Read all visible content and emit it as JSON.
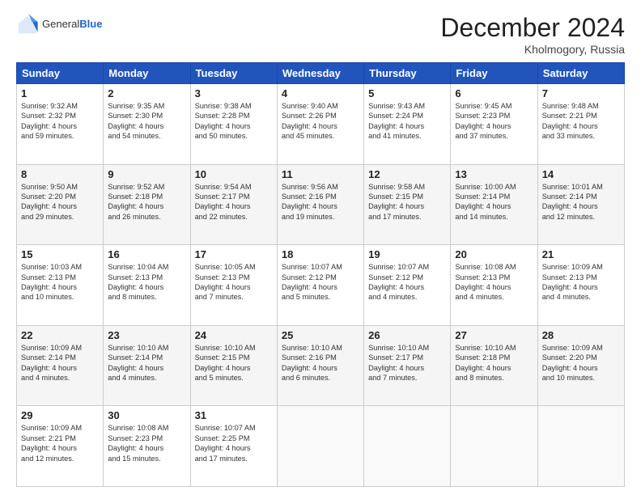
{
  "header": {
    "logo_general": "General",
    "logo_blue": "Blue",
    "title": "December 2024",
    "location": "Kholmogory, Russia"
  },
  "days_of_week": [
    "Sunday",
    "Monday",
    "Tuesday",
    "Wednesday",
    "Thursday",
    "Friday",
    "Saturday"
  ],
  "weeks": [
    [
      {
        "day": "1",
        "sunrise": "9:32 AM",
        "sunset": "2:32 PM",
        "daylight": "4 hours and 59 minutes."
      },
      {
        "day": "2",
        "sunrise": "9:35 AM",
        "sunset": "2:30 PM",
        "daylight": "4 hours and 54 minutes."
      },
      {
        "day": "3",
        "sunrise": "9:38 AM",
        "sunset": "2:28 PM",
        "daylight": "4 hours and 50 minutes."
      },
      {
        "day": "4",
        "sunrise": "9:40 AM",
        "sunset": "2:26 PM",
        "daylight": "4 hours and 45 minutes."
      },
      {
        "day": "5",
        "sunrise": "9:43 AM",
        "sunset": "2:24 PM",
        "daylight": "4 hours and 41 minutes."
      },
      {
        "day": "6",
        "sunrise": "9:45 AM",
        "sunset": "2:23 PM",
        "daylight": "4 hours and 37 minutes."
      },
      {
        "day": "7",
        "sunrise": "9:48 AM",
        "sunset": "2:21 PM",
        "daylight": "4 hours and 33 minutes."
      }
    ],
    [
      {
        "day": "8",
        "sunrise": "9:50 AM",
        "sunset": "2:20 PM",
        "daylight": "4 hours and 29 minutes."
      },
      {
        "day": "9",
        "sunrise": "9:52 AM",
        "sunset": "2:18 PM",
        "daylight": "4 hours and 26 minutes."
      },
      {
        "day": "10",
        "sunrise": "9:54 AM",
        "sunset": "2:17 PM",
        "daylight": "4 hours and 22 minutes."
      },
      {
        "day": "11",
        "sunrise": "9:56 AM",
        "sunset": "2:16 PM",
        "daylight": "4 hours and 19 minutes."
      },
      {
        "day": "12",
        "sunrise": "9:58 AM",
        "sunset": "2:15 PM",
        "daylight": "4 hours and 17 minutes."
      },
      {
        "day": "13",
        "sunrise": "10:00 AM",
        "sunset": "2:14 PM",
        "daylight": "4 hours and 14 minutes."
      },
      {
        "day": "14",
        "sunrise": "10:01 AM",
        "sunset": "2:14 PM",
        "daylight": "4 hours and 12 minutes."
      }
    ],
    [
      {
        "day": "15",
        "sunrise": "10:03 AM",
        "sunset": "2:13 PM",
        "daylight": "4 hours and 10 minutes."
      },
      {
        "day": "16",
        "sunrise": "10:04 AM",
        "sunset": "2:13 PM",
        "daylight": "4 hours and 8 minutes."
      },
      {
        "day": "17",
        "sunrise": "10:05 AM",
        "sunset": "2:13 PM",
        "daylight": "4 hours and 7 minutes."
      },
      {
        "day": "18",
        "sunrise": "10:07 AM",
        "sunset": "2:12 PM",
        "daylight": "4 hours and 5 minutes."
      },
      {
        "day": "19",
        "sunrise": "10:07 AM",
        "sunset": "2:12 PM",
        "daylight": "4 hours and 4 minutes."
      },
      {
        "day": "20",
        "sunrise": "10:08 AM",
        "sunset": "2:13 PM",
        "daylight": "4 hours and 4 minutes."
      },
      {
        "day": "21",
        "sunrise": "10:09 AM",
        "sunset": "2:13 PM",
        "daylight": "4 hours and 4 minutes."
      }
    ],
    [
      {
        "day": "22",
        "sunrise": "10:09 AM",
        "sunset": "2:14 PM",
        "daylight": "4 hours and 4 minutes."
      },
      {
        "day": "23",
        "sunrise": "10:10 AM",
        "sunset": "2:14 PM",
        "daylight": "4 hours and 4 minutes."
      },
      {
        "day": "24",
        "sunrise": "10:10 AM",
        "sunset": "2:15 PM",
        "daylight": "4 hours and 5 minutes."
      },
      {
        "day": "25",
        "sunrise": "10:10 AM",
        "sunset": "2:16 PM",
        "daylight": "4 hours and 6 minutes."
      },
      {
        "day": "26",
        "sunrise": "10:10 AM",
        "sunset": "2:17 PM",
        "daylight": "4 hours and 7 minutes."
      },
      {
        "day": "27",
        "sunrise": "10:10 AM",
        "sunset": "2:18 PM",
        "daylight": "4 hours and 8 minutes."
      },
      {
        "day": "28",
        "sunrise": "10:09 AM",
        "sunset": "2:20 PM",
        "daylight": "4 hours and 10 minutes."
      }
    ],
    [
      {
        "day": "29",
        "sunrise": "10:09 AM",
        "sunset": "2:21 PM",
        "daylight": "4 hours and 12 minutes."
      },
      {
        "day": "30",
        "sunrise": "10:08 AM",
        "sunset": "2:23 PM",
        "daylight": "4 hours and 15 minutes."
      },
      {
        "day": "31",
        "sunrise": "10:07 AM",
        "sunset": "2:25 PM",
        "daylight": "4 hours and 17 minutes."
      },
      null,
      null,
      null,
      null
    ]
  ],
  "labels": {
    "sunrise": "Sunrise:",
    "sunset": "Sunset:",
    "daylight": "Daylight:"
  }
}
